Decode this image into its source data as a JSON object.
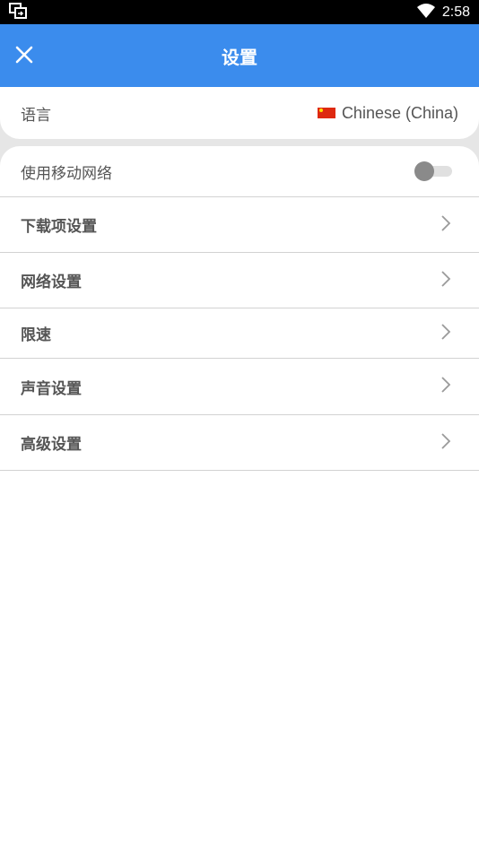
{
  "status_bar": {
    "time": "2:58",
    "left_icon": "screen-mirror-icon",
    "right_icon": "wifi-icon"
  },
  "app_bar": {
    "title": "设置",
    "close_icon": "close-icon",
    "color": "#3b8ced"
  },
  "language": {
    "label": "语言",
    "value": "Chinese (China)",
    "flag_icon": "china-flag-icon"
  },
  "settings": {
    "mobile_network": {
      "label": "使用移动网络",
      "enabled": false
    },
    "items": [
      {
        "label": "下载项设置"
      },
      {
        "label": "网络设置"
      },
      {
        "label": "限速"
      },
      {
        "label": "声音设置"
      },
      {
        "label": "高级设置"
      }
    ]
  }
}
